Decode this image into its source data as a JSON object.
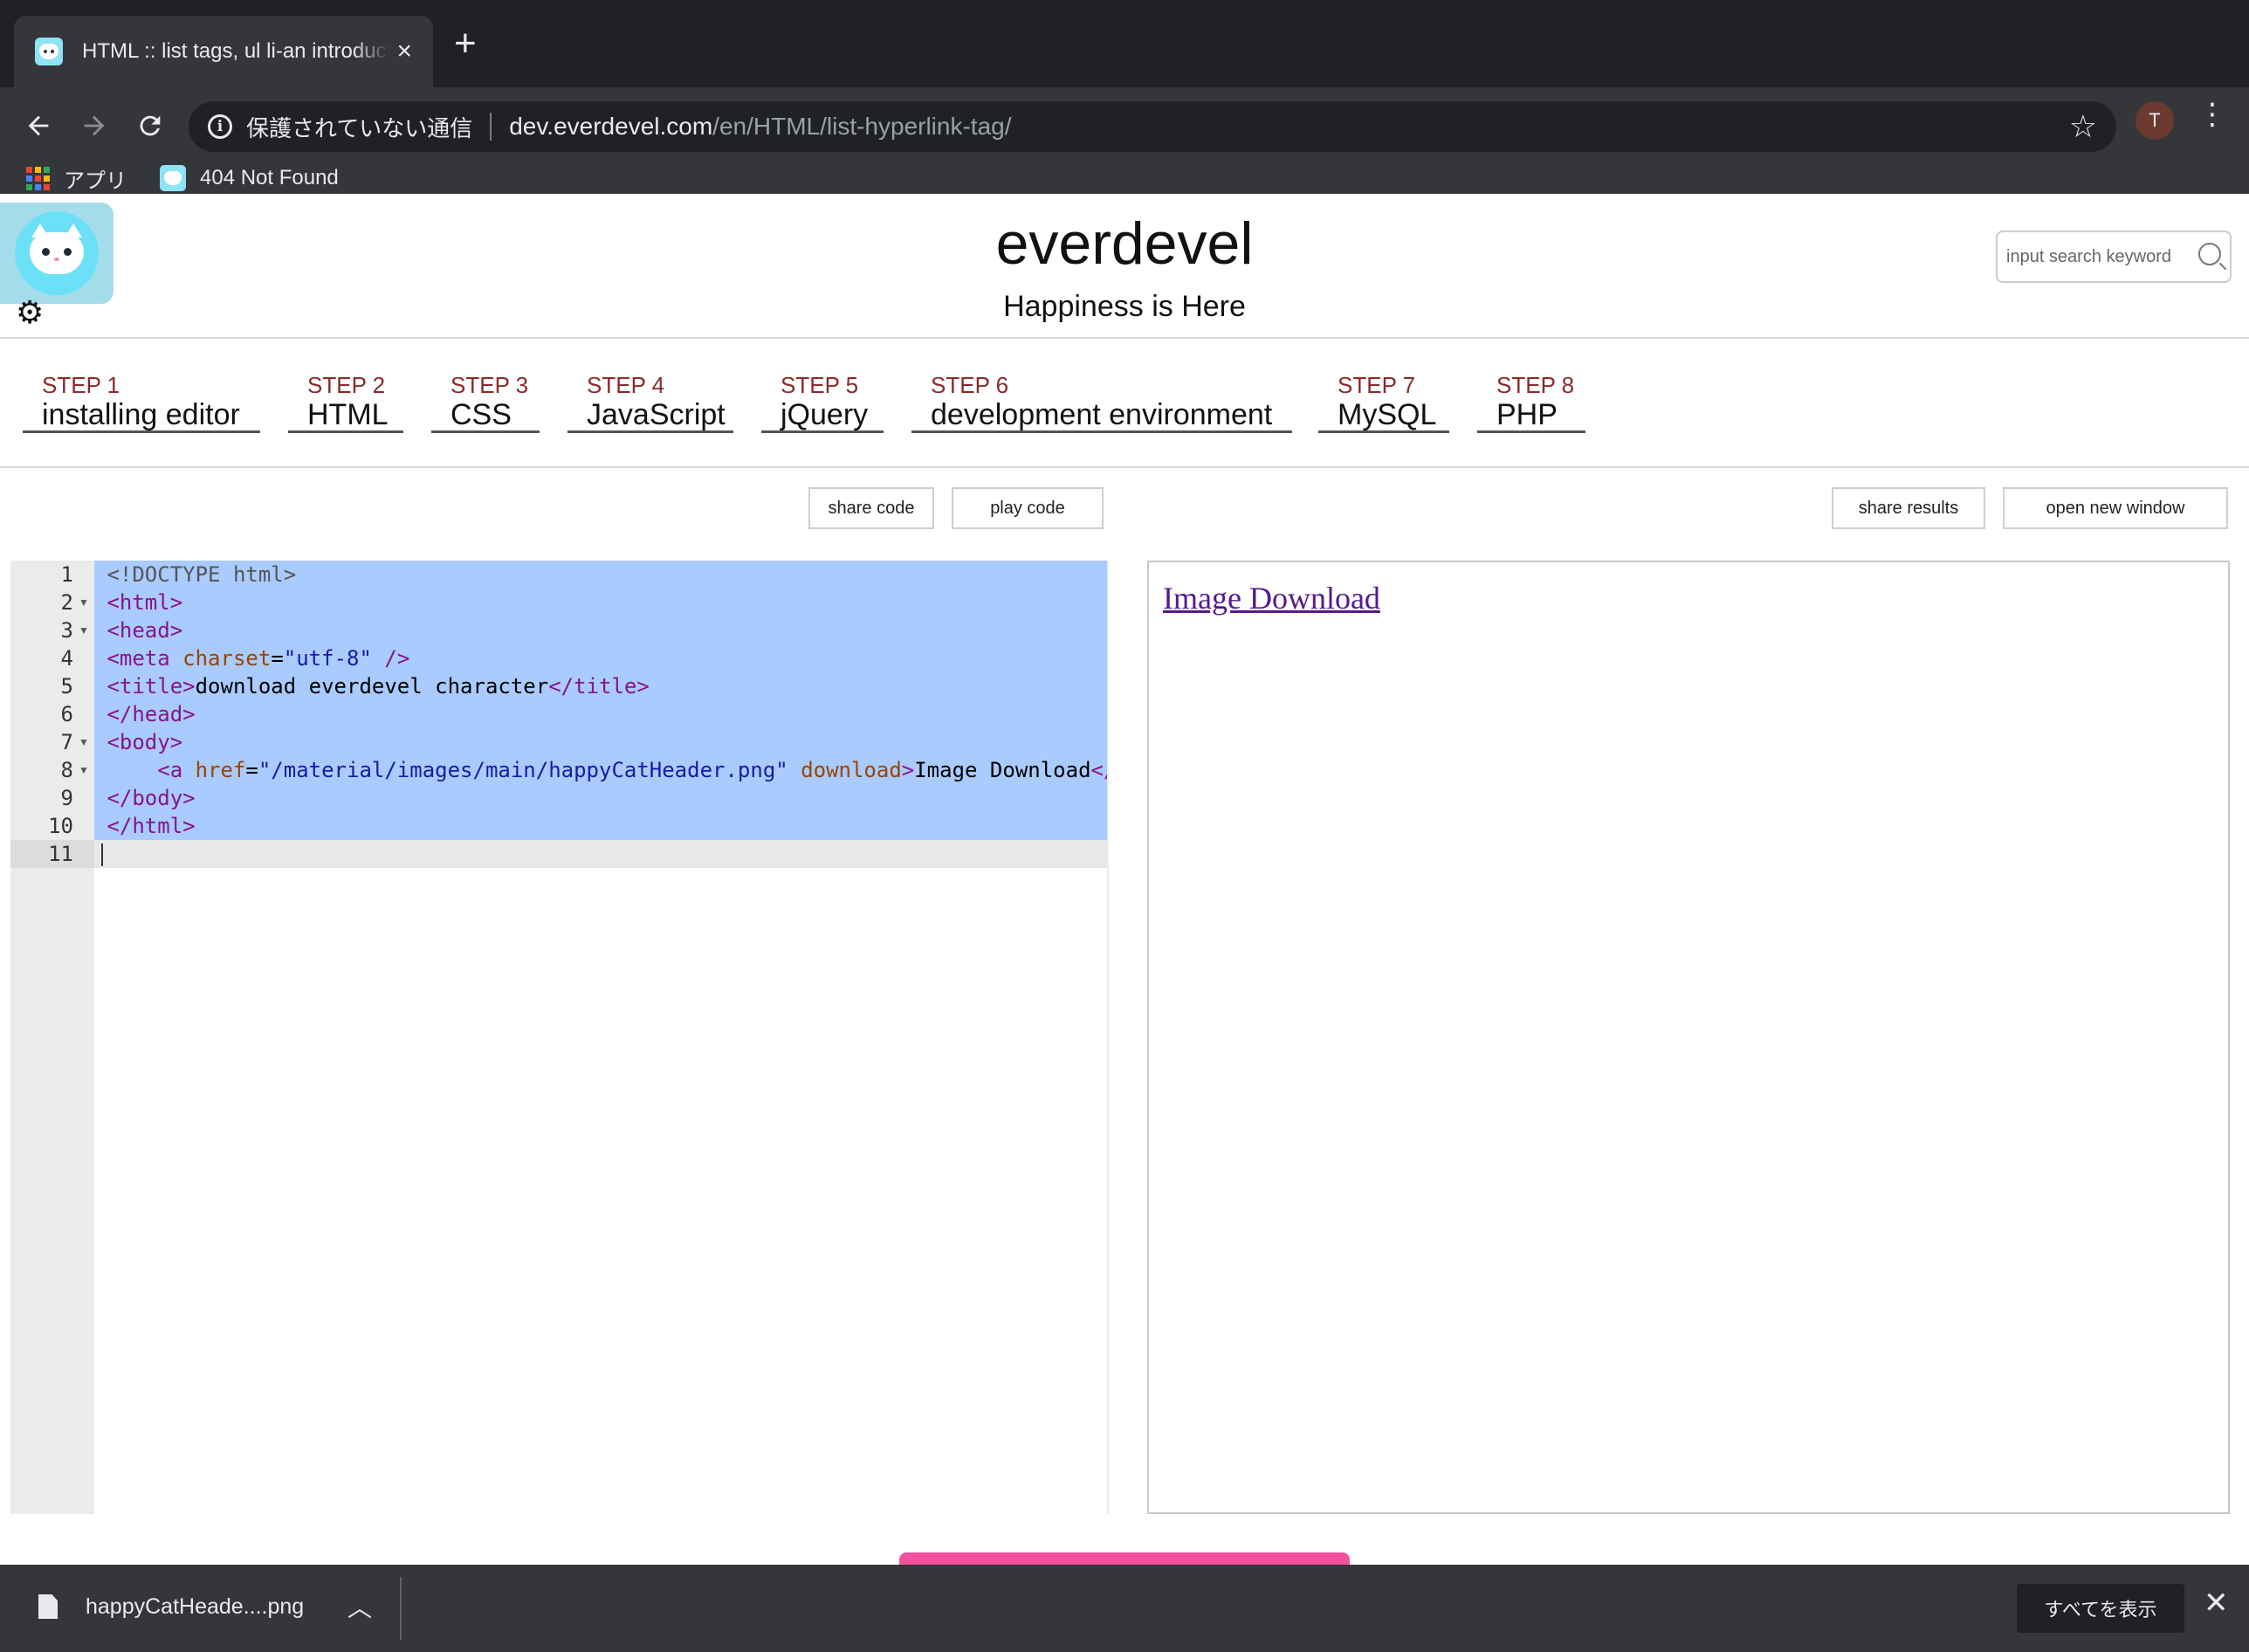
{
  "browser": {
    "tab_title": "HTML :: list tags, ul li-an introduction",
    "new_tab_icon": "plus-icon",
    "security_text": "保護されていない通信",
    "url_host": "dev.everdevel.com",
    "url_path": "/en/HTML/list-hyperlink-tag/",
    "profile_initial": "T",
    "bookmarks": [
      {
        "label": "アプリ",
        "icon": "apps-grid-icon"
      },
      {
        "label": "404 Not Found",
        "icon": "cat-favicon"
      }
    ]
  },
  "site": {
    "title": "everdevel",
    "subtitle": "Happiness is Here",
    "search_placeholder": "input search keyword"
  },
  "steps": [
    {
      "num": "STEP 1",
      "name": "installing editor"
    },
    {
      "num": "STEP 2",
      "name": "HTML"
    },
    {
      "num": "STEP 3",
      "name": "CSS"
    },
    {
      "num": "STEP 4",
      "name": "JavaScript"
    },
    {
      "num": "STEP 5",
      "name": "jQuery"
    },
    {
      "num": "STEP 6",
      "name": "development environment"
    },
    {
      "num": "STEP 7",
      "name": "MySQL"
    },
    {
      "num": "STEP 8",
      "name": "PHP"
    }
  ],
  "actions": {
    "share_code": "share code",
    "play_code": "play code",
    "share_results": "share results",
    "open_new_window": "open new window"
  },
  "editor": {
    "line_numbers": [
      "1",
      "2",
      "3",
      "4",
      "5",
      "6",
      "7",
      "8",
      "9",
      "10",
      "11"
    ],
    "selected_lines": 10,
    "current_line": 11
  },
  "preview": {
    "link_text": "Image Download"
  },
  "downloads": {
    "file_name": "happyCatHeade....png",
    "show_all": "すべてを表示"
  },
  "colors": {
    "selection": "#a9cbfd",
    "step_number": "#8b2a2a",
    "logo_bg": "#a5dcec",
    "accent_pink": "#f4519c"
  }
}
